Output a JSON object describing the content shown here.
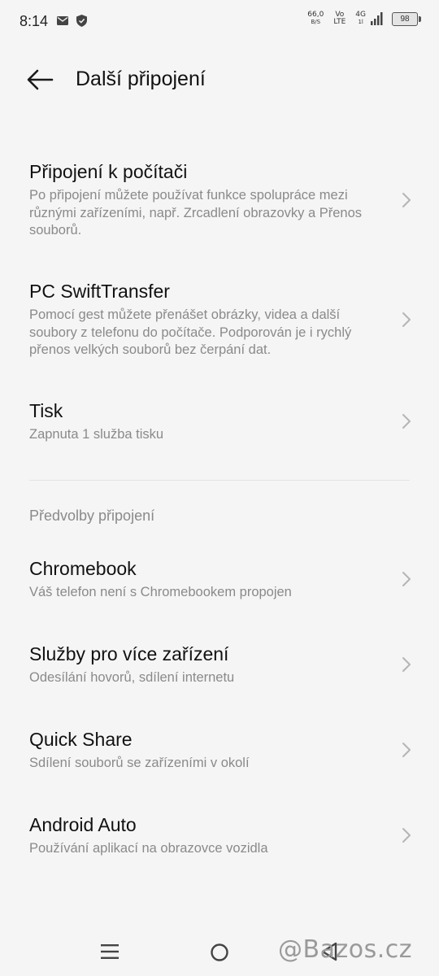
{
  "status_bar": {
    "time": "8:14",
    "net_speed_value": "66,0",
    "net_speed_unit": "B/S",
    "volte_top": "Vo",
    "volte_bottom": "LTE",
    "network_type": "4G",
    "signal_sub": "1l",
    "battery_level": "98"
  },
  "header": {
    "title": "Další připojení"
  },
  "items": [
    {
      "title": "Připojení k počítači",
      "desc": "Po připojení můžete používat funkce spolupráce mezi různými zařízeními, např. Zrcadlení obrazovky a Přenos souborů."
    },
    {
      "title": "PC SwiftTransfer",
      "desc": "Pomocí gest můžete přenášet obrázky, videa a další soubory z telefonu do počítače. Podporován je i rychlý přenos velkých souborů bez čerpání dat."
    },
    {
      "title": "Tisk",
      "desc": "Zapnuta 1 služba tisku"
    }
  ],
  "section": {
    "header": "Předvolby připojení",
    "items": [
      {
        "title": "Chromebook",
        "desc": "Váš telefon není s Chromebookem propojen"
      },
      {
        "title": "Služby pro více zařízení",
        "desc": "Odesílání hovorů, sdílení internetu"
      },
      {
        "title": "Quick Share",
        "desc": "Sdílení souborů se zařízeními v okolí"
      },
      {
        "title": "Android Auto",
        "desc": "Používání aplikací na obrazovce vozidla"
      }
    ]
  },
  "watermark": "@Bazos.cz",
  "colors": {
    "background": "#f5f5f5",
    "primary_text": "#111111",
    "secondary_text": "#8a8a8a",
    "chevron": "#b5b5b5"
  }
}
